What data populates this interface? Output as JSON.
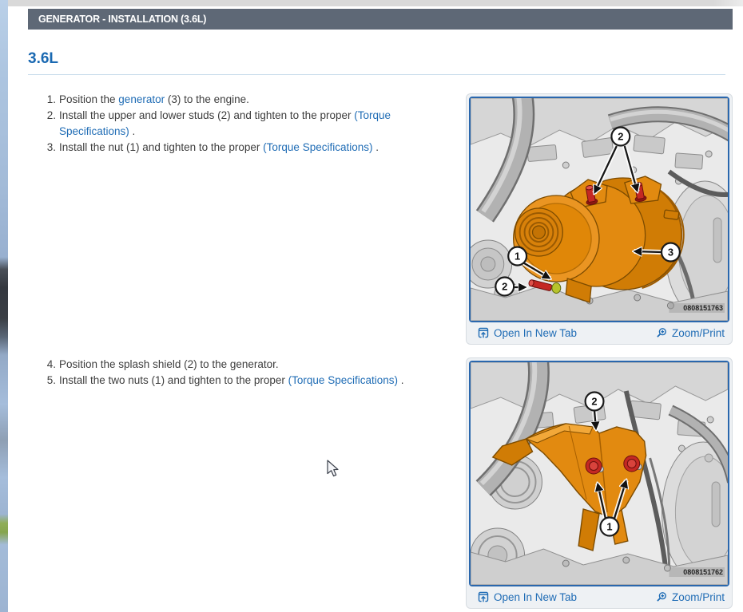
{
  "header": {
    "title": "GENERATOR - INSTALLATION (3.6L)"
  },
  "section": {
    "heading": "3.6L"
  },
  "steps": [
    {
      "num": "1.",
      "pre": "Position the ",
      "link": "generator",
      "post": " (3) to the engine."
    },
    {
      "num": "2.",
      "pre": "Install the upper and lower studs (2) and tighten to the proper ",
      "link": "(Torque Specifications)",
      "post": " ."
    },
    {
      "num": "3.",
      "pre": "Install the nut (1) and tighten to the proper ",
      "link": "(Torque Specifications)",
      "post": " ."
    },
    {
      "num": "4.",
      "pre": "Position the splash shield (2) to the generator.",
      "link": "",
      "post": ""
    },
    {
      "num": "5.",
      "pre": "Install the two nuts (1) and tighten to the proper ",
      "link": "(Torque Specifications)",
      "post": " ."
    }
  ],
  "figure1": {
    "watermark": "0808151763",
    "open_label": "Open In New Tab",
    "zoom_label": "Zoom/Print",
    "callout_1": "1",
    "callout_2_top": "2",
    "callout_2_side": "2",
    "callout_3": "3"
  },
  "figure2": {
    "watermark": "0808151762",
    "open_label": "Open In New Tab",
    "zoom_label": "Zoom/Print",
    "callout_1": "1",
    "callout_2": "2"
  },
  "colors": {
    "accent_blue": "#1f6cb5",
    "header_bg": "#5e6876",
    "heading_blue": "#1a69b2",
    "generator_orange": "#e28a10",
    "fastener_red": "#c42823"
  }
}
